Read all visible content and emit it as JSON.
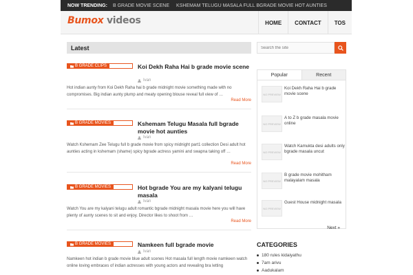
{
  "trending": {
    "label": "NOW TRENDING:",
    "items": [
      "B GRADE MOVIE SCENE",
      "KSHEMAM TELUGU MASALA FULL BGRADE MOVIE HOT AUNTIES"
    ]
  },
  "logo": {
    "part1": "Bumox",
    "part2": "videos"
  },
  "nav": [
    "HOME",
    "CONTACT",
    "TOS"
  ],
  "main": {
    "section_title": "Latest",
    "posts": [
      {
        "category": "B GRADE CLIPS",
        "title": "Koi Dekh Raha Hai b grade movie scene",
        "author": "Ivan",
        "excerpt": "Hot indian aunty from Koi Dekh Raha hai b grade midnight movie something made with no compromises. Big indian aunty plump and meaty opening blouse reveal full view of …",
        "more": "Read More"
      },
      {
        "category": "B GRADE MOVIES",
        "title": "Kshemam Telugu Masala full bgrade movie hot aunties",
        "author": "Ivan",
        "excerpt": "Watch Kshemam Zee Telugu full b grade movie from spicy midnight part1 collection Desi adult hot aunties acting in kshemam (shame) spicy bgrade actress yamini and swapna taking off …",
        "more": "Read More"
      },
      {
        "category": "B GRADE MOVIES",
        "title": "Hot bgrade You are my kalyani telugu masala",
        "author": "Ivan",
        "excerpt": "Watch You are my kalyani telugu adult romantic bgrade midnight masala movie here you will have plenty of aunty scenes to sit and enjoy. Director likes to shoot from …",
        "more": "Read More"
      },
      {
        "category": "B GRADE MOVIES",
        "title": "Namkeen full bgrade movie",
        "author": "Ivan",
        "excerpt": "Namkeen hot indian b grade movie blue adult scenes Hot masala full length movie namkeen watch online loving embraces of indian actresses with young actors and revealing bra letting",
        "more": ""
      }
    ]
  },
  "sidebar": {
    "search_placeholder": "Search the site",
    "tabs": [
      "Popular",
      "Recent"
    ],
    "thumb_text": "NO PREVIEW",
    "popular": [
      "Koi Dekh Raha Hai b grade movie scene",
      "A to Z b grade masala movie online",
      "Watch Kamukta desi adults only bgrade masala uncut",
      "B grade movie mohitham malayalam masala",
      "Guest House midnight masala"
    ],
    "next": "Next »",
    "categories_title": "CATEGORIES",
    "categories": [
      "180 rules kidaiyathu",
      "7am arivu",
      "Aadukalam"
    ]
  },
  "colors": {
    "accent": "#e8541d",
    "topbar": "#2b2b2b"
  }
}
